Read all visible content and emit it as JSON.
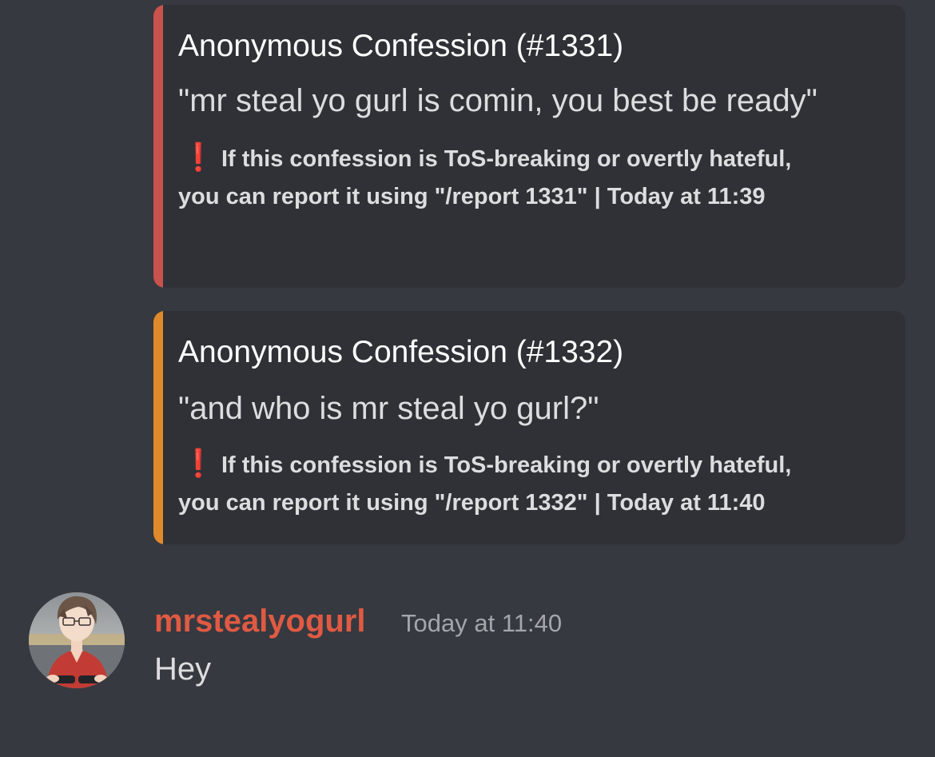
{
  "embeds": [
    {
      "accent_color": "#c9524e",
      "title": "Anonymous Confession (#1331)",
      "description": "\"mr steal yo gurl is comin, you best be ready\"",
      "footer_icon": "exclamation-icon",
      "footer_icon_glyph": "❗",
      "footer_line1": "If this confession is ToS-breaking or overtly hateful,",
      "footer_line2": "you can report it using \"/report 1331\" | Today at 11:39"
    },
    {
      "accent_color": "#e08a2c",
      "title": "Anonymous Confession (#1332)",
      "description": "\"and who is mr steal yo gurl?\"",
      "footer_icon": "exclamation-icon",
      "footer_icon_glyph": "❗",
      "footer_line1": "If this confession is ToS-breaking or overtly hateful,",
      "footer_line2": "you can report it using \"/report 1332\" | Today at 11:40"
    }
  ],
  "message": {
    "avatar_icon": "user-avatar",
    "username": "mrstealyogurl",
    "username_color": "#e05a43",
    "timestamp": "Today at 11:40",
    "content": "Hey"
  }
}
